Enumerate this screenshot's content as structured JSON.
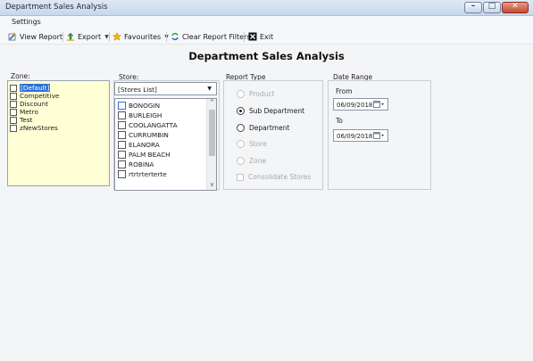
{
  "window": {
    "title": "Department Sales Analysis",
    "controls": {
      "minimize": "–",
      "maximize": "□",
      "close": "✕"
    }
  },
  "menu": {
    "items": [
      {
        "label": "Settings"
      }
    ]
  },
  "toolbar": {
    "view_report": "View Report",
    "export": "Export",
    "favourites": "Favourites",
    "clear_filters": "Clear Report Filters",
    "exit": "Exit",
    "icons": [
      "view-report-icon",
      "export-icon",
      "favourites-icon",
      "clear-filters-icon",
      "exit-icon"
    ]
  },
  "page": {
    "title": "Department Sales Analysis"
  },
  "zone": {
    "label": "Zone:",
    "items": [
      "[Default]",
      "Competitive",
      "Discount",
      "Metro",
      "Test",
      "zNewStores"
    ],
    "selected_index": 0
  },
  "store": {
    "label": "Store:",
    "combo_value": "[Stores List]",
    "items": [
      "BONOGIN",
      "BURLEIGH",
      "COOLANGATTA",
      "CURRUMBIN",
      "ELANORA",
      "PALM BEACH",
      "ROBINA",
      "rtrtrterterte"
    ],
    "scroll_up": "^",
    "scroll_down": "v"
  },
  "report_type": {
    "label": "Report Type",
    "options": [
      {
        "label": "Product",
        "enabled": false,
        "selected": false
      },
      {
        "label": "Sub Department",
        "enabled": true,
        "selected": true
      },
      {
        "label": "Department",
        "enabled": true,
        "selected": false
      },
      {
        "label": "Store",
        "enabled": false,
        "selected": false
      },
      {
        "label": "Zone",
        "enabled": false,
        "selected": false
      }
    ],
    "consolidate": {
      "label": "Consolidate Stores",
      "enabled": false,
      "checked": false
    }
  },
  "date_range": {
    "label": "Date Range",
    "from_label": "From",
    "from_value": "06/09/2018",
    "to_label": "To",
    "to_value": "06/09/2018"
  },
  "colors": {
    "accent": "#2e6fd6",
    "zone_bg": "#ffffd5",
    "title_bar": "#c7d7ea"
  }
}
